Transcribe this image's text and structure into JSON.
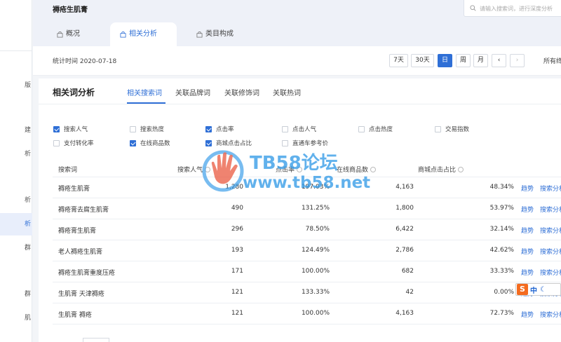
{
  "sidebar": {
    "items": [
      {
        "label": "版"
      },
      {
        "label": "建"
      },
      {
        "label": "析"
      },
      {
        "label": "析"
      },
      {
        "label": "析"
      },
      {
        "label": "群"
      },
      {
        "label": "群"
      },
      {
        "label": "肌"
      }
    ]
  },
  "header": {
    "title": "褥疮生肌膏",
    "search": {
      "placeholder": "请输入搜索词，进行深度分析"
    },
    "tabs": [
      {
        "label": "概况",
        "icon": "bag-icon"
      },
      {
        "label": "相关分析",
        "icon": "bag-icon",
        "active": true
      },
      {
        "label": "类目构成",
        "icon": "bag-icon"
      }
    ]
  },
  "statbar": {
    "label": "统计时间 2020-07-18",
    "periods": [
      "7天",
      "30天",
      "日",
      "周",
      "月"
    ],
    "active_period": "日",
    "prev": "‹",
    "next": "›",
    "right": "所有终端"
  },
  "panel": {
    "title": "相关词分析",
    "tabs": [
      "相关搜索词",
      "关联品牌词",
      "关联修饰词",
      "关联热词"
    ],
    "metrics": [
      {
        "label": "搜索人气",
        "checked": true
      },
      {
        "label": "搜索热度",
        "checked": false
      },
      {
        "label": "点击率",
        "checked": true
      },
      {
        "label": "点击人气",
        "checked": false
      },
      {
        "label": "点击热度",
        "checked": false
      },
      {
        "label": "交易指数",
        "checked": false
      },
      {
        "label": "支付转化率",
        "checked": false
      },
      {
        "label": "在线商品数",
        "checked": true
      },
      {
        "label": "商城点击占比",
        "checked": true
      },
      {
        "label": "直通车参考价",
        "checked": false
      }
    ],
    "columns": [
      "搜索词",
      "搜索人气",
      "点击率",
      "在线商品数",
      "商城点击占比"
    ],
    "actions": [
      "趋势",
      "搜索分析",
      "人群"
    ],
    "rows": [
      {
        "keyword": "褥疮生肌膏",
        "popularity": "1,280",
        "ctr": "197.03%",
        "products": "4,163",
        "mall_ratio": "48.34%"
      },
      {
        "keyword": "褥疮膏去腐生肌膏",
        "popularity": "490",
        "ctr": "131.25%",
        "products": "1,800",
        "mall_ratio": "53.97%"
      },
      {
        "keyword": "褥疮膏生肌膏",
        "popularity": "296",
        "ctr": "78.50%",
        "products": "6,422",
        "mall_ratio": "32.14%"
      },
      {
        "keyword": "老人褥疮生肌膏",
        "popularity": "193",
        "ctr": "124.49%",
        "products": "2,786",
        "mall_ratio": "42.62%"
      },
      {
        "keyword": "褥疮生肌膏重度压疮",
        "popularity": "171",
        "ctr": "100.00%",
        "products": "682",
        "mall_ratio": "33.33%"
      },
      {
        "keyword": "生肌膏 天津褥疮",
        "popularity": "121",
        "ctr": "133.33%",
        "products": "42",
        "mall_ratio": "0.00%"
      },
      {
        "keyword": "生肌膏 褥疮",
        "popularity": "121",
        "ctr": "100.00%",
        "products": "4,163",
        "mall_ratio": "72.73%"
      }
    ]
  },
  "watermark": {
    "title": "TB58论坛",
    "url": "www.tb58.net"
  },
  "ime": {
    "logo": "S",
    "lang": "中",
    "mode": "☾"
  },
  "colors": {
    "accent": "#2f6fd6",
    "watermark": "#3a9ee8",
    "ime": "#f46b1f"
  }
}
